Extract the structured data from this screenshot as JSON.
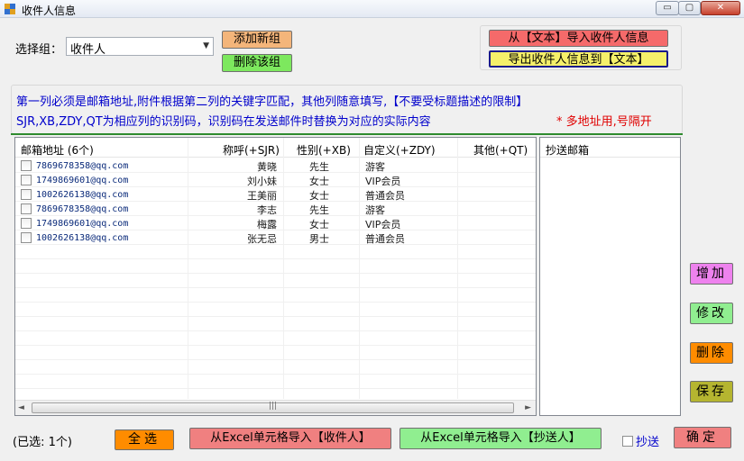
{
  "window": {
    "title": "收件人信息",
    "min_glyph": "▭",
    "max_glyph": "▢",
    "close_glyph": "✕"
  },
  "group": {
    "label": "选择组：",
    "selected": "收件人",
    "add_label": "添加新组",
    "delete_label": "删除该组"
  },
  "text_io": {
    "import_label": "从【文本】导入收件人信息",
    "export_label": "导出收件人信息到【文本】"
  },
  "info": {
    "line1": "第一列必须是邮箱地址,附件根据第二列的关键字匹配，其他列随意填写,【不要受标题描述的限制】",
    "line2": "SJR,XB,ZDY,QT为相应列的识别码，识别码在发送邮件时替换为对应的实际内容",
    "note": "* 多地址用,号隔开"
  },
  "table": {
    "headers": {
      "email": "邮箱地址 (6个)",
      "name": "称呼(+SJR)",
      "gender": "性别(+XB)",
      "custom": "自定义(+ZDY)",
      "other": "其他(+QT)"
    },
    "rows": [
      {
        "email": "7869678358@qq.com",
        "name": "黄晓",
        "gender": "先生",
        "custom": "游客"
      },
      {
        "email": "1749869601@qq.com",
        "name": "刘小妹",
        "gender": "女士",
        "custom": "VIP会员"
      },
      {
        "email": "1002626138@qq.com",
        "name": "王美丽",
        "gender": "女士",
        "custom": "普通会员"
      },
      {
        "email": "7869678358@qq.com",
        "name": "李志",
        "gender": "先生",
        "custom": "游客"
      },
      {
        "email": "1749869601@qq.com",
        "name": "梅露",
        "gender": "女士",
        "custom": "VIP会员"
      },
      {
        "email": "1002626138@qq.com",
        "name": "张无忌",
        "gender": "男士",
        "custom": "普通会员"
      }
    ],
    "scroll_left": "◄",
    "scroll_right": "►",
    "scroll_grip": "|||"
  },
  "cc": {
    "title": "抄送邮箱"
  },
  "side": {
    "add": "增加",
    "edit": "修改",
    "delete": "删除",
    "save": "保存"
  },
  "footer": {
    "selected_count": "(已选: 1个)",
    "select_all": "全选",
    "import_recipient": "从Excel单元格导入【收件人】",
    "import_cc": "从Excel单元格导入【抄送人】",
    "cc_label": "抄送",
    "ok": "确定"
  }
}
